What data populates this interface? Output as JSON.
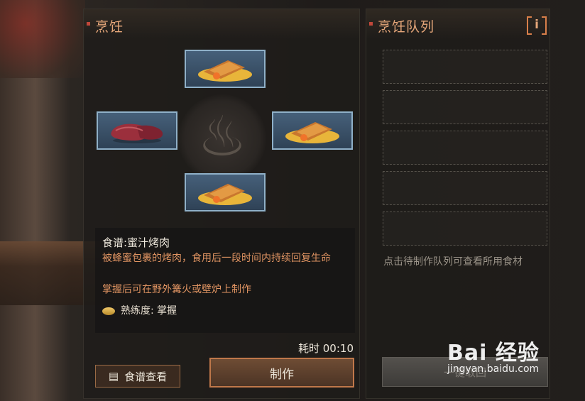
{
  "cooking": {
    "title": "烹饪",
    "recipe_name": "食谱:蜜汁烤肉",
    "description": "被蜂蜜包裹的烤肉，食用后一段时间内持续回复生命",
    "note": "掌握后可在野外篝火或壁炉上制作",
    "proficiency": "熟练度: 掌握",
    "time": "耗时 00:10",
    "view_recipe_label": "食谱查看",
    "make_label": "制作",
    "ingredients": [
      {
        "slot": "top",
        "item": "honey-meat"
      },
      {
        "slot": "left",
        "item": "raw-meat"
      },
      {
        "slot": "right",
        "item": "honey-meat"
      },
      {
        "slot": "bottom",
        "item": "honey-meat"
      }
    ]
  },
  "queue": {
    "title": "烹饪队列",
    "hint": "点击待制作队列可查看所用食材",
    "collect_label": "一键取回",
    "info_label": "i"
  },
  "watermark": {
    "logo": "Bai 经验",
    "url": "jingyan.baidu.com"
  }
}
